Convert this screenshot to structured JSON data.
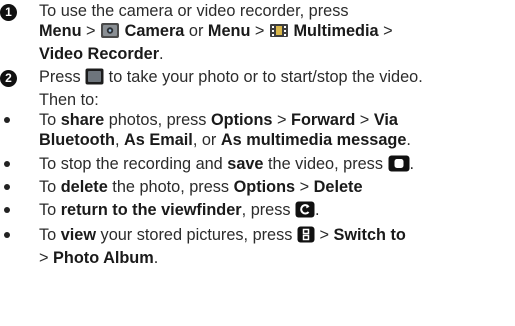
{
  "steps": [
    {
      "number": "1",
      "t1": "To use the camera or video recorder, press",
      "menu1": "Menu",
      "sep1": " > ",
      "camera": "Camera",
      "or": " or ",
      "menu2": "Menu",
      "sep2": " > ",
      "multimedia": "Multimedia",
      "sep3": " > ",
      "video_recorder": "Video Recorder",
      "end": "."
    },
    {
      "number": "2",
      "t1": "Press ",
      "t2": " to take your photo or to start/stop the video.",
      "t3": "Then to:"
    }
  ],
  "bullets": [
    {
      "a": "To ",
      "b": "share",
      "c": " photos, press ",
      "d": "Options",
      "e": " > ",
      "f": "Forward",
      "g": " > ",
      "h": "Via",
      "i": "Bluetooth",
      "j": ", ",
      "k": "As Email",
      "l": ", or ",
      "m": "As multimedia message",
      "n": "."
    },
    {
      "a": "To stop the recording and ",
      "b": "save",
      "c": " the video, press ",
      "d": "."
    },
    {
      "a": "To ",
      "b": "delete",
      "c": " the photo, press ",
      "d": "Options",
      "e": " > ",
      "f": "Delete"
    },
    {
      "a": "To ",
      "b": "return to the viewfinder",
      "c": ", press ",
      "d": "."
    },
    {
      "a": "To ",
      "b": "view",
      "c": " your stored pictures, press ",
      "d": " > ",
      "e": "Switch to",
      "f": "> ",
      "g": "Photo Album",
      "h": "."
    }
  ],
  "icons": {
    "camera_app": "camera-app-icon",
    "multimedia_app": "multimedia-app-icon",
    "capture_key": "capture-key-icon",
    "stop_record_key": "stop-record-key-icon",
    "back_key": "back-key-icon",
    "menu_key": "menu-key-icon"
  }
}
